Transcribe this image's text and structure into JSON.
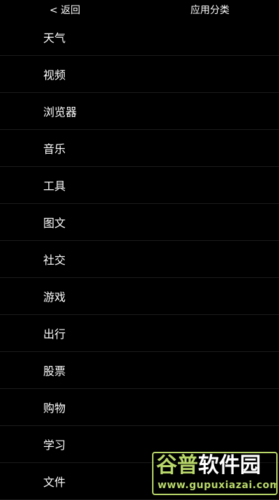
{
  "header": {
    "back_label": "< 返回",
    "title": "应用分类"
  },
  "categories": [
    {
      "label": "天气"
    },
    {
      "label": "视频"
    },
    {
      "label": "浏览器"
    },
    {
      "label": "音乐"
    },
    {
      "label": "工具"
    },
    {
      "label": "图文"
    },
    {
      "label": "社交"
    },
    {
      "label": "游戏"
    },
    {
      "label": "出行"
    },
    {
      "label": "股票"
    },
    {
      "label": "购物"
    },
    {
      "label": "学习"
    },
    {
      "label": "文件"
    }
  ],
  "watermark": {
    "brand_part1": "谷普",
    "brand_part2": "软件园",
    "url": "www.gupuxiazai.com"
  },
  "colors": {
    "background": "#000000",
    "text": "#ffffff",
    "divider": "#1c1c1c",
    "watermark_green": "#b9d86a"
  }
}
